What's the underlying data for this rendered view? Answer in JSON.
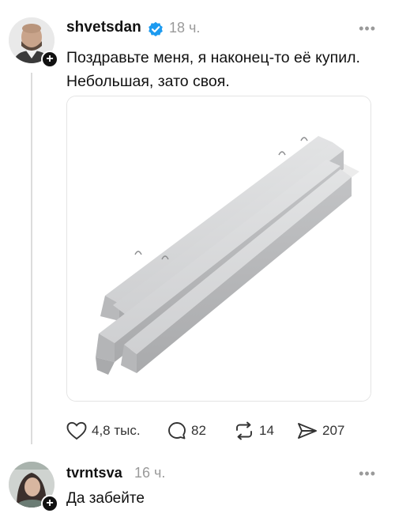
{
  "post": {
    "username": "shvetsdan",
    "time": "18 ч.",
    "more": "•••",
    "text": "Поздравьте меня, я наконец-то её купил. Небольшая, зато своя.",
    "plus": "+",
    "actions": {
      "likes": "4,8 тыс.",
      "comments": "82",
      "reposts": "14",
      "shares": "207"
    }
  },
  "reply": {
    "username": "tvrntsva",
    "time": "16 ч.",
    "more": "•••",
    "text": "Да забейте",
    "plus": "+"
  },
  "colors": {
    "verified": "#1d9bf0",
    "muted": "#9a9a9a",
    "concrete": "#c9cacc"
  }
}
